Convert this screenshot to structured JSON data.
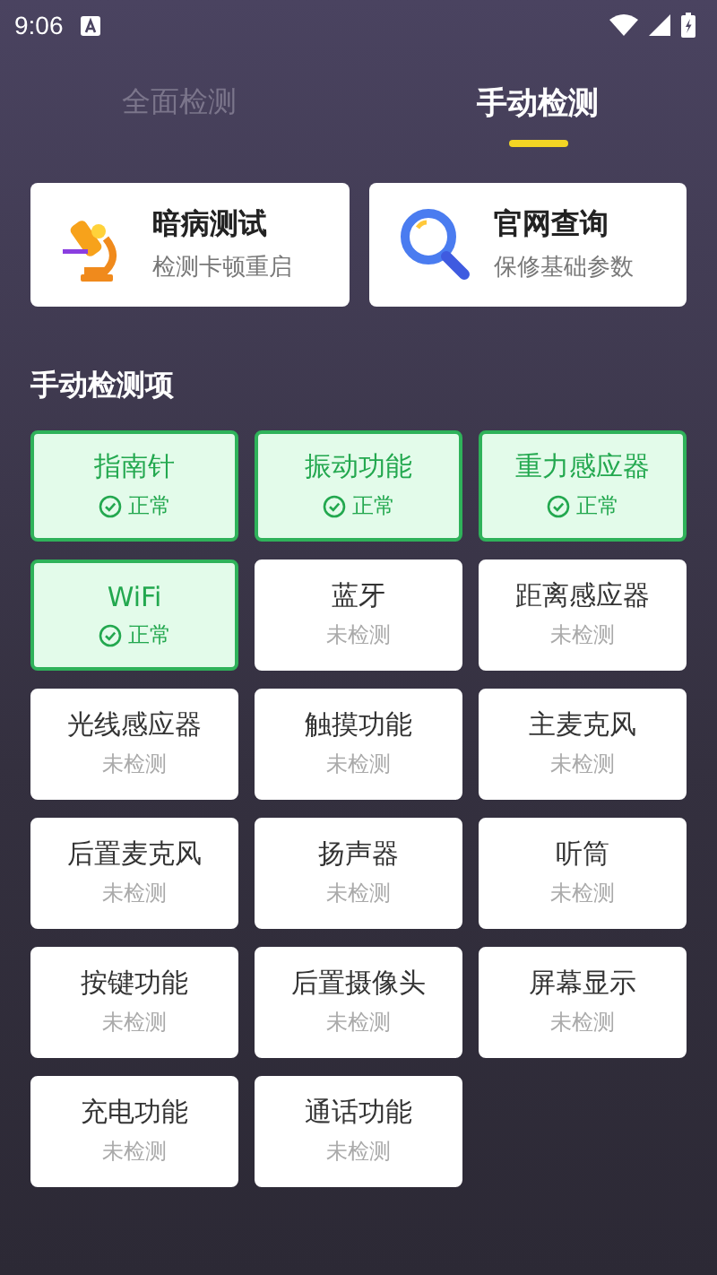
{
  "status_bar": {
    "time": "9:06"
  },
  "tabs": [
    {
      "label": "全面检测",
      "selected": false
    },
    {
      "label": "手动检测",
      "selected": true
    }
  ],
  "cards": [
    {
      "kind": "microscope",
      "title": "暗病测试",
      "subtitle": "检测卡顿重启"
    },
    {
      "kind": "search",
      "title": "官网查询",
      "subtitle": "保修基础参数"
    }
  ],
  "section_title": "手动检测项",
  "items": [
    {
      "name": "指南针",
      "status": "正常",
      "passed": true
    },
    {
      "name": "振动功能",
      "status": "正常",
      "passed": true
    },
    {
      "name": "重力感应器",
      "status": "正常",
      "passed": true
    },
    {
      "name": "WiFi",
      "status": "正常",
      "passed": true
    },
    {
      "name": "蓝牙",
      "status": "未检测",
      "passed": false
    },
    {
      "name": "距离感应器",
      "status": "未检测",
      "passed": false
    },
    {
      "name": "光线感应器",
      "status": "未检测",
      "passed": false
    },
    {
      "name": "触摸功能",
      "status": "未检测",
      "passed": false
    },
    {
      "name": "主麦克风",
      "status": "未检测",
      "passed": false
    },
    {
      "name": "后置麦克风",
      "status": "未检测",
      "passed": false
    },
    {
      "name": "扬声器",
      "status": "未检测",
      "passed": false
    },
    {
      "name": "听筒",
      "status": "未检测",
      "passed": false
    },
    {
      "name": "按键功能",
      "status": "未检测",
      "passed": false
    },
    {
      "name": "后置摄像头",
      "status": "未检测",
      "passed": false
    },
    {
      "name": "屏幕显示",
      "status": "未检测",
      "passed": false
    },
    {
      "name": "充电功能",
      "status": "未检测",
      "passed": false
    },
    {
      "name": "通话功能",
      "status": "未检测",
      "passed": false
    }
  ]
}
